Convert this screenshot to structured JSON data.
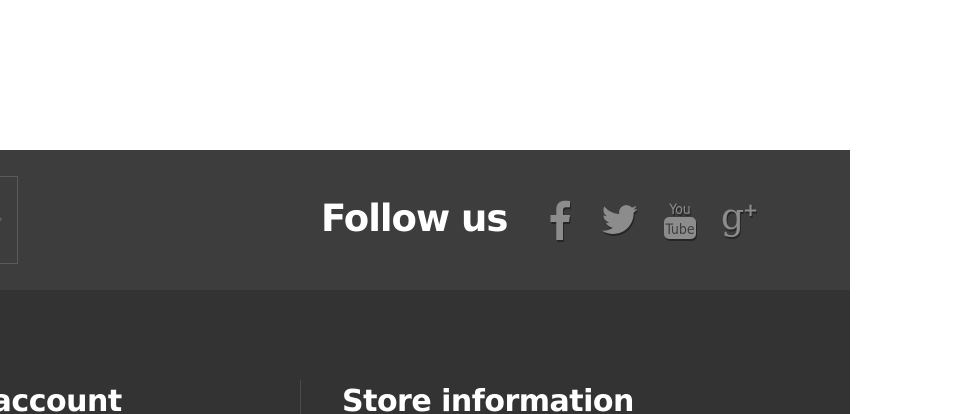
{
  "footer": {
    "follow": {
      "title": "Follow us",
      "networks": [
        {
          "name": "facebook",
          "icon": "facebook-icon"
        },
        {
          "name": "twitter",
          "icon": "twitter-icon"
        },
        {
          "name": "youtube",
          "icon": "youtube-icon",
          "logo_text_top": "You",
          "logo_text_bottom": "Tube"
        },
        {
          "name": "google-plus",
          "icon": "google-plus-icon",
          "logo_text": "g+"
        }
      ]
    },
    "columns": {
      "account_title": "Your account",
      "store_title": "Store information"
    }
  },
  "colors": {
    "follow_bar_bg": "#3d3d3d",
    "links_bg": "#333333",
    "icon": "#8c8c8c",
    "title": "#ffffff"
  }
}
